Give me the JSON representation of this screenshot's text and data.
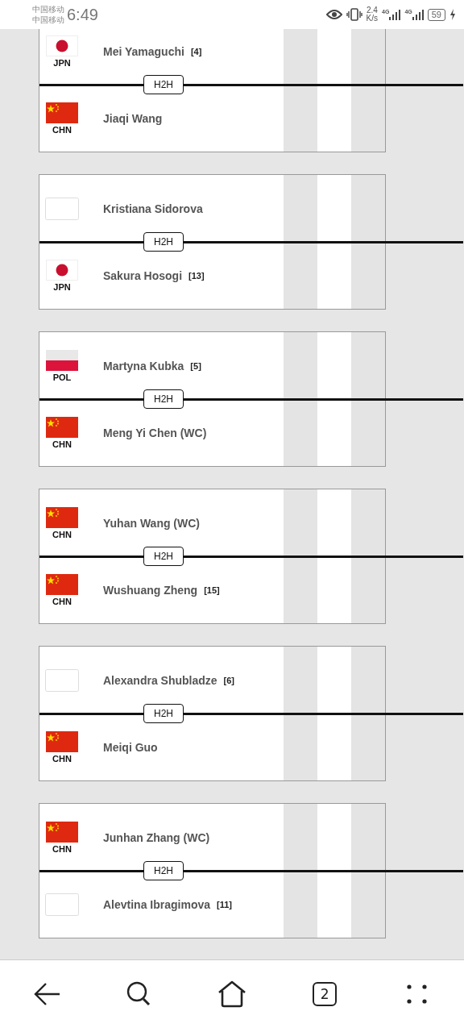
{
  "status_bar": {
    "carriers": [
      "中国移动",
      "中国移动"
    ],
    "time": "6:49",
    "speed": "2.4",
    "speed_unit": "K/s",
    "networks": [
      "4G",
      "4G"
    ],
    "battery": "59"
  },
  "matches": [
    {
      "players": [
        {
          "kind": "jpn",
          "country": "JPN",
          "name": "Mei Yamaguchi",
          "seed": "[4]"
        },
        {
          "kind": "chn",
          "country": "CHN",
          "name": "Jiaqi Wang"
        }
      ],
      "h2h": "H2H"
    },
    {
      "players": [
        {
          "kind": "blank",
          "name": "Kristiana Sidorova"
        },
        {
          "kind": "jpn",
          "country": "JPN",
          "name": "Sakura Hosogi",
          "seed": "[13]"
        }
      ],
      "h2h": "H2H"
    },
    {
      "players": [
        {
          "kind": "pol",
          "country": "POL",
          "name": "Martyna Kubka",
          "seed": "[5]"
        },
        {
          "kind": "chn",
          "country": "CHN",
          "name": "Meng Yi Chen (WC)"
        }
      ],
      "h2h": "H2H"
    },
    {
      "players": [
        {
          "kind": "chn",
          "country": "CHN",
          "name": "Yuhan Wang (WC)"
        },
        {
          "kind": "chn",
          "country": "CHN",
          "name": "Wushuang Zheng",
          "seed": "[15]"
        }
      ],
      "h2h": "H2H"
    },
    {
      "players": [
        {
          "kind": "blank",
          "name": "Alexandra Shubladze",
          "seed": "[6]"
        },
        {
          "kind": "chn",
          "country": "CHN",
          "name": "Meiqi Guo"
        }
      ],
      "h2h": "H2H"
    },
    {
      "players": [
        {
          "kind": "chn",
          "country": "CHN",
          "name": "Junhan Zhang (WC)"
        },
        {
          "kind": "blank",
          "name": "Alevtina Ibragimova",
          "seed": "[11]"
        }
      ],
      "h2h": "H2H"
    }
  ],
  "nav": {
    "tab_count": "2"
  }
}
